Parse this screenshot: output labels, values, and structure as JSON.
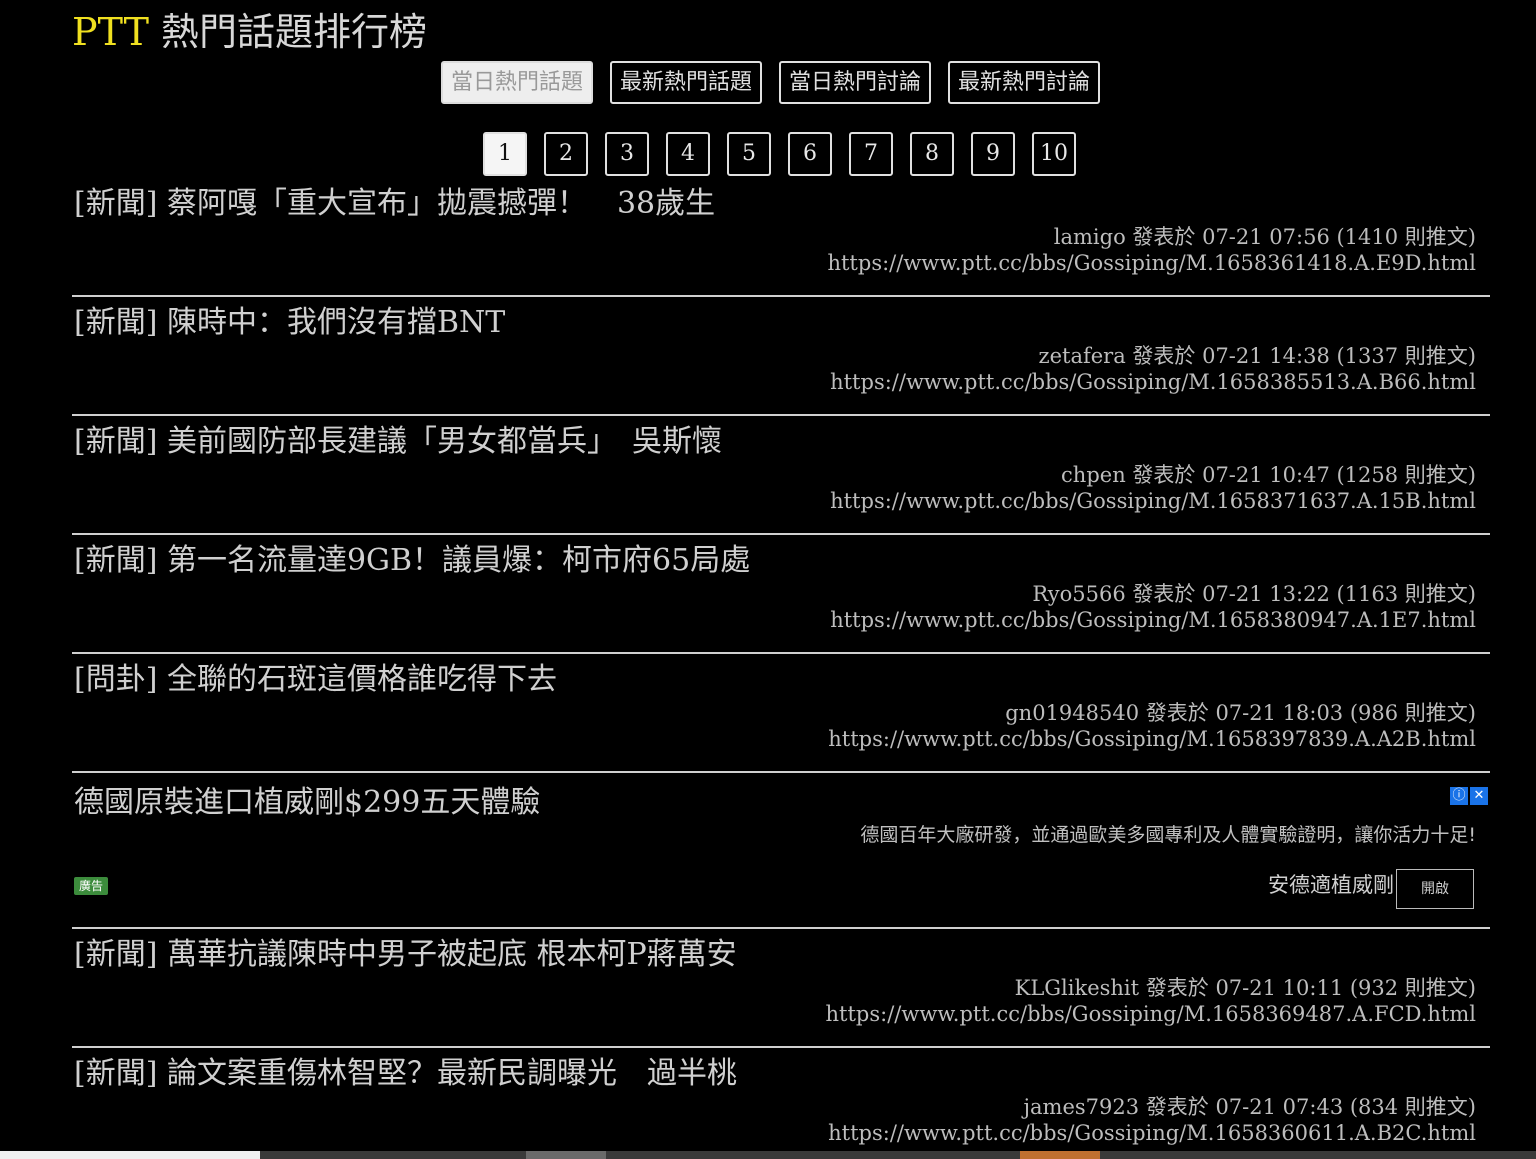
{
  "header": {
    "brand": "PTT",
    "title_rest": " 熱門話題排行榜"
  },
  "tabs": [
    {
      "label": "當日熱門話題",
      "active": true
    },
    {
      "label": "最新熱門話題",
      "active": false
    },
    {
      "label": "當日熱門討論",
      "active": false
    },
    {
      "label": "最新熱門討論",
      "active": false
    }
  ],
  "pagination": {
    "pages": [
      "1",
      "2",
      "3",
      "4",
      "5",
      "6",
      "7",
      "8",
      "9",
      "10"
    ],
    "current": "1"
  },
  "posts": [
    {
      "title": "[新聞] 蔡阿嘎「重大宣布」拋震撼彈！　38歲生",
      "meta": "lamigo 發表於 07-21 07:56 (1410 則推文)",
      "url": "https://www.ptt.cc/bbs/Gossiping/M.1658361418.A.E9D.html"
    },
    {
      "title": "[新聞] 陳時中：我們沒有擋BNT",
      "meta": "zetafera 發表於 07-21 14:38 (1337 則推文)",
      "url": "https://www.ptt.cc/bbs/Gossiping/M.1658385513.A.B66.html"
    },
    {
      "title": "[新聞] 美前國防部長建議「男女都當兵」　吳斯懷",
      "meta": "chpen 發表於 07-21 10:47 (1258 則推文)",
      "url": "https://www.ptt.cc/bbs/Gossiping/M.1658371637.A.15B.html"
    },
    {
      "title": "[新聞] 第一名流量達9GB！議員爆：柯市府65局處",
      "meta": "Ryo5566 發表於 07-21 13:22 (1163 則推文)",
      "url": "https://www.ptt.cc/bbs/Gossiping/M.1658380947.A.1E7.html"
    },
    {
      "title": "[問卦] 全聯的石斑這價格誰吃得下去",
      "meta": "gn01948540 發表於 07-21 18:03 (986 則推文)",
      "url": "https://www.ptt.cc/bbs/Gossiping/M.1658397839.A.A2B.html"
    }
  ],
  "ad": {
    "title": "德國原裝進口植威剛$299五天體驗",
    "description": "德國百年大廠研發，並通過歐美多國專利及人體實驗證明，讓你活力十足!",
    "badge": "廣告",
    "advertiser": "安德適植威剛",
    "open_label": "開啟",
    "info_icon": "ⓘ",
    "close_icon": "✕"
  },
  "posts_after_ad": [
    {
      "title": "[新聞] 萬華抗議陳時中男子被起底 根本柯P蔣萬安",
      "meta": "KLGlikeshit 發表於 07-21 10:11 (932 則推文)",
      "url": "https://www.ptt.cc/bbs/Gossiping/M.1658369487.A.FCD.html"
    },
    {
      "title": "[新聞] 論文案重傷林智堅？最新民調曝光　過半桃",
      "meta": "james7923 發表於 07-21 07:43 (834 則推文)",
      "url": "https://www.ptt.cc/bbs/Gossiping/M.1658360611.A.B2C.html"
    }
  ]
}
